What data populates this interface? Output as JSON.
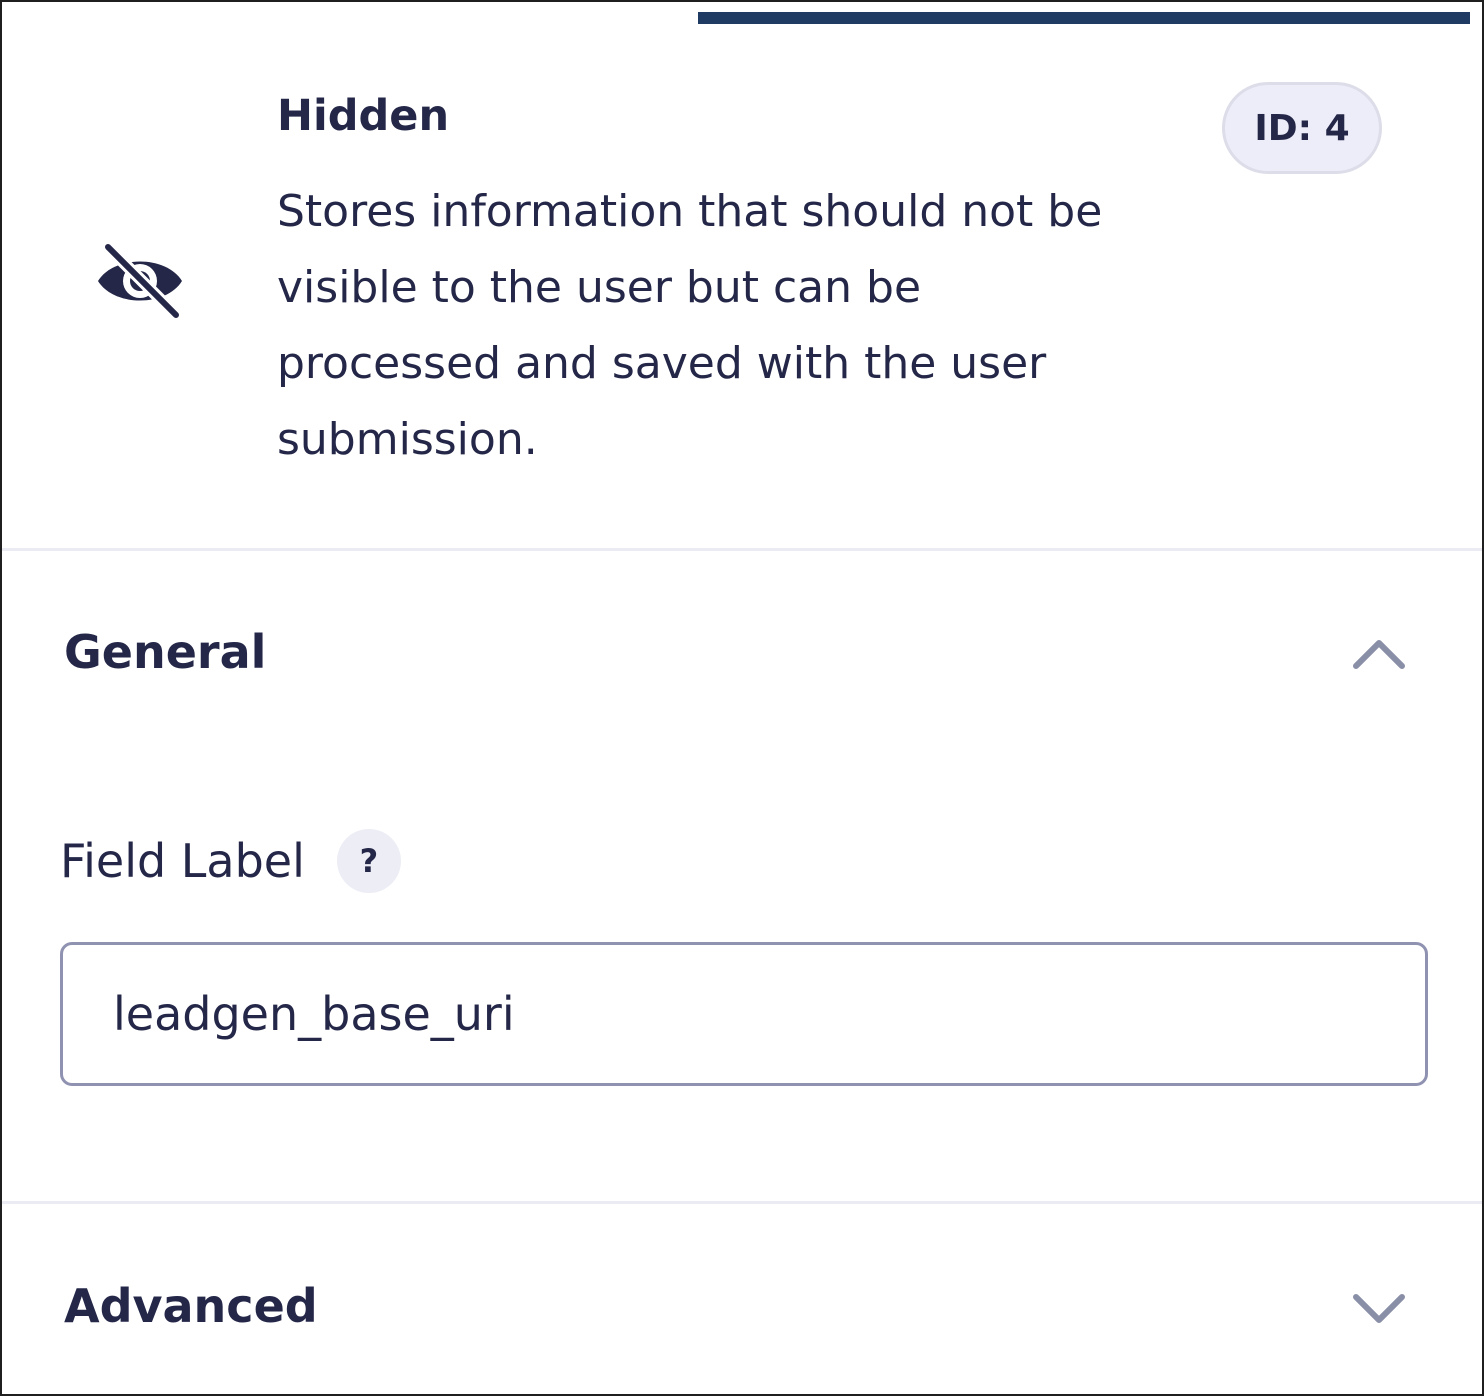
{
  "field": {
    "type_title": "Hidden",
    "description": "Stores information that should not be visible to the user but can be processed and saved with the user submission.",
    "id_badge": "ID: 4",
    "icon": "eye-slash-icon"
  },
  "sections": {
    "general": {
      "title": "General",
      "expanded": true,
      "toggle_icon": "chevron-up-icon"
    },
    "advanced": {
      "title": "Advanced",
      "expanded": false,
      "toggle_icon": "chevron-down-icon"
    }
  },
  "field_label": {
    "label": "Field Label",
    "help": "?",
    "value": "leadgen_base_uri"
  },
  "colors": {
    "text": "#242748",
    "active_bar": "#1f3b63",
    "badge_bg": "#ecedf8",
    "input_border": "#9092b2",
    "chevron": "#8a8fa8"
  }
}
